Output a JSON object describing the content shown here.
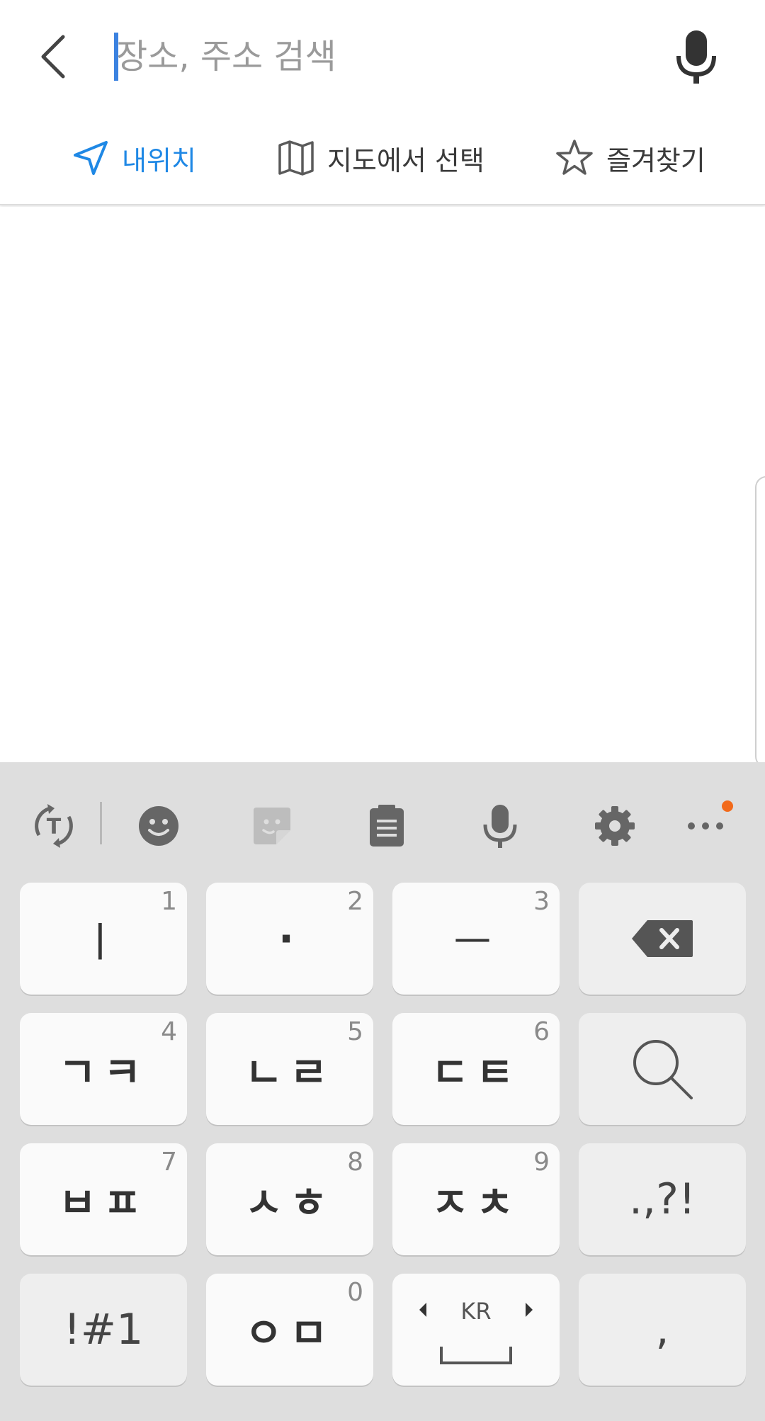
{
  "search": {
    "placeholder": "장소, 주소 검색",
    "back_icon": "back-arrow-icon",
    "voice_icon": "microphone-icon"
  },
  "options": [
    {
      "label": "내위치",
      "icon": "navigation-arrow-icon",
      "active": true
    },
    {
      "label": "지도에서 선택",
      "icon": "map-icon",
      "active": false
    },
    {
      "label": "즐겨찾기",
      "icon": "star-icon",
      "active": false
    }
  ],
  "keyboard": {
    "toolbar_icons": [
      "text-convert-icon",
      "emoji-icon",
      "sticker-icon",
      "clipboard-icon",
      "microphone-icon",
      "settings-icon",
      "more-icon"
    ],
    "keys": [
      {
        "main": "ㅣ",
        "number": "1"
      },
      {
        "main": "·",
        "number": "2"
      },
      {
        "main": "ㅡ",
        "number": "3"
      },
      {
        "main": "",
        "icon": "backspace-icon"
      },
      {
        "main": "ㄱㅋ",
        "number": "4"
      },
      {
        "main": "ㄴㄹ",
        "number": "5"
      },
      {
        "main": "ㄷㅌ",
        "number": "6"
      },
      {
        "main": "",
        "icon": "search-icon"
      },
      {
        "main": "ㅂㅍ",
        "number": "7"
      },
      {
        "main": "ㅅㅎ",
        "number": "8"
      },
      {
        "main": "ㅈㅊ",
        "number": "9"
      },
      {
        "main": ".,?!"
      },
      {
        "main": "!#1"
      },
      {
        "main": "ㅇㅁ",
        "number": "0"
      },
      {
        "main": "KR",
        "icon": "space-icon"
      },
      {
        "main": ","
      }
    ]
  },
  "colors": {
    "accent": "#1f88e5",
    "caret": "#3b82e0",
    "keyboard_bg": "#dedede",
    "notify_dot": "#f26a1b"
  }
}
